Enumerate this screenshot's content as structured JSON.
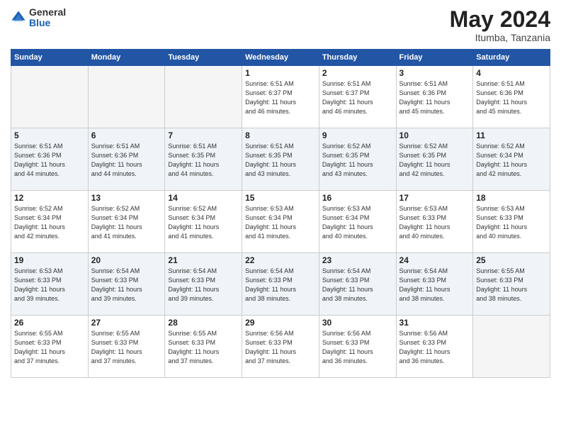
{
  "header": {
    "logo_general": "General",
    "logo_blue": "Blue",
    "month": "May 2024",
    "location": "Itumba, Tanzania"
  },
  "weekdays": [
    "Sunday",
    "Monday",
    "Tuesday",
    "Wednesday",
    "Thursday",
    "Friday",
    "Saturday"
  ],
  "weeks": [
    [
      {
        "day": "",
        "info": ""
      },
      {
        "day": "",
        "info": ""
      },
      {
        "day": "",
        "info": ""
      },
      {
        "day": "1",
        "info": "Sunrise: 6:51 AM\nSunset: 6:37 PM\nDaylight: 11 hours\nand 46 minutes."
      },
      {
        "day": "2",
        "info": "Sunrise: 6:51 AM\nSunset: 6:37 PM\nDaylight: 11 hours\nand 46 minutes."
      },
      {
        "day": "3",
        "info": "Sunrise: 6:51 AM\nSunset: 6:36 PM\nDaylight: 11 hours\nand 45 minutes."
      },
      {
        "day": "4",
        "info": "Sunrise: 6:51 AM\nSunset: 6:36 PM\nDaylight: 11 hours\nand 45 minutes."
      }
    ],
    [
      {
        "day": "5",
        "info": "Sunrise: 6:51 AM\nSunset: 6:36 PM\nDaylight: 11 hours\nand 44 minutes."
      },
      {
        "day": "6",
        "info": "Sunrise: 6:51 AM\nSunset: 6:36 PM\nDaylight: 11 hours\nand 44 minutes."
      },
      {
        "day": "7",
        "info": "Sunrise: 6:51 AM\nSunset: 6:35 PM\nDaylight: 11 hours\nand 44 minutes."
      },
      {
        "day": "8",
        "info": "Sunrise: 6:51 AM\nSunset: 6:35 PM\nDaylight: 11 hours\nand 43 minutes."
      },
      {
        "day": "9",
        "info": "Sunrise: 6:52 AM\nSunset: 6:35 PM\nDaylight: 11 hours\nand 43 minutes."
      },
      {
        "day": "10",
        "info": "Sunrise: 6:52 AM\nSunset: 6:35 PM\nDaylight: 11 hours\nand 42 minutes."
      },
      {
        "day": "11",
        "info": "Sunrise: 6:52 AM\nSunset: 6:34 PM\nDaylight: 11 hours\nand 42 minutes."
      }
    ],
    [
      {
        "day": "12",
        "info": "Sunrise: 6:52 AM\nSunset: 6:34 PM\nDaylight: 11 hours\nand 42 minutes."
      },
      {
        "day": "13",
        "info": "Sunrise: 6:52 AM\nSunset: 6:34 PM\nDaylight: 11 hours\nand 41 minutes."
      },
      {
        "day": "14",
        "info": "Sunrise: 6:52 AM\nSunset: 6:34 PM\nDaylight: 11 hours\nand 41 minutes."
      },
      {
        "day": "15",
        "info": "Sunrise: 6:53 AM\nSunset: 6:34 PM\nDaylight: 11 hours\nand 41 minutes."
      },
      {
        "day": "16",
        "info": "Sunrise: 6:53 AM\nSunset: 6:34 PM\nDaylight: 11 hours\nand 40 minutes."
      },
      {
        "day": "17",
        "info": "Sunrise: 6:53 AM\nSunset: 6:33 PM\nDaylight: 11 hours\nand 40 minutes."
      },
      {
        "day": "18",
        "info": "Sunrise: 6:53 AM\nSunset: 6:33 PM\nDaylight: 11 hours\nand 40 minutes."
      }
    ],
    [
      {
        "day": "19",
        "info": "Sunrise: 6:53 AM\nSunset: 6:33 PM\nDaylight: 11 hours\nand 39 minutes."
      },
      {
        "day": "20",
        "info": "Sunrise: 6:54 AM\nSunset: 6:33 PM\nDaylight: 11 hours\nand 39 minutes."
      },
      {
        "day": "21",
        "info": "Sunrise: 6:54 AM\nSunset: 6:33 PM\nDaylight: 11 hours\nand 39 minutes."
      },
      {
        "day": "22",
        "info": "Sunrise: 6:54 AM\nSunset: 6:33 PM\nDaylight: 11 hours\nand 38 minutes."
      },
      {
        "day": "23",
        "info": "Sunrise: 6:54 AM\nSunset: 6:33 PM\nDaylight: 11 hours\nand 38 minutes."
      },
      {
        "day": "24",
        "info": "Sunrise: 6:54 AM\nSunset: 6:33 PM\nDaylight: 11 hours\nand 38 minutes."
      },
      {
        "day": "25",
        "info": "Sunrise: 6:55 AM\nSunset: 6:33 PM\nDaylight: 11 hours\nand 38 minutes."
      }
    ],
    [
      {
        "day": "26",
        "info": "Sunrise: 6:55 AM\nSunset: 6:33 PM\nDaylight: 11 hours\nand 37 minutes."
      },
      {
        "day": "27",
        "info": "Sunrise: 6:55 AM\nSunset: 6:33 PM\nDaylight: 11 hours\nand 37 minutes."
      },
      {
        "day": "28",
        "info": "Sunrise: 6:55 AM\nSunset: 6:33 PM\nDaylight: 11 hours\nand 37 minutes."
      },
      {
        "day": "29",
        "info": "Sunrise: 6:56 AM\nSunset: 6:33 PM\nDaylight: 11 hours\nand 37 minutes."
      },
      {
        "day": "30",
        "info": "Sunrise: 6:56 AM\nSunset: 6:33 PM\nDaylight: 11 hours\nand 36 minutes."
      },
      {
        "day": "31",
        "info": "Sunrise: 6:56 AM\nSunset: 6:33 PM\nDaylight: 11 hours\nand 36 minutes."
      },
      {
        "day": "",
        "info": ""
      }
    ]
  ]
}
